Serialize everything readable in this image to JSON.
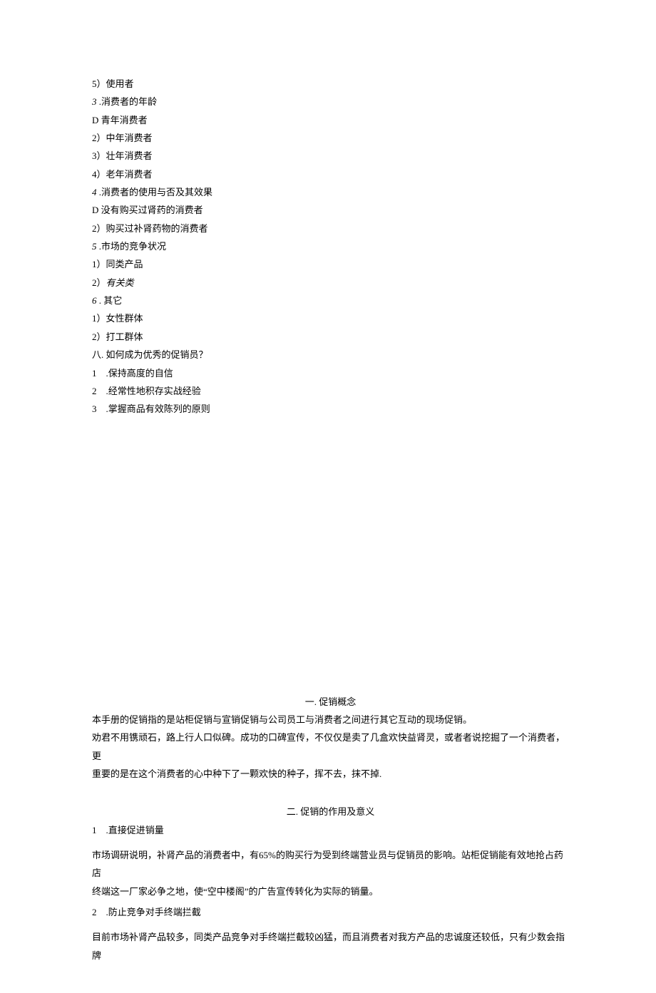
{
  "upper": {
    "l01": "5）使用者",
    "l02_num": "3",
    "l02_txt": " .消费者的年龄",
    "l03": "D 青年消费者",
    "l04": "2）中年消费者",
    "l05": "3）壮年消费者",
    "l06": "4）老年消费者",
    "l07_num": "4",
    "l07_txt": " .消费者的使用与否及其效果",
    "l08": "D 没有购买过肾药的消费者",
    "l09": "2）购买过补肾药物的消费者",
    "l10_num": "5",
    "l10_txt": " .市场的竞争状况",
    "l11": "1）同类产品",
    "l12_pre": "2）",
    "l12_txt": "有关类",
    "l13_num": "6",
    "l13_txt": " . 其它",
    "l14": "1）女性群体",
    "l15": "2）打工群体",
    "l16": "八. 如何成为优秀的促销员？",
    "l17": "1　.保持高度的自信",
    "l18": "2　.经常性地积存实战经验",
    "l19": "3　.掌握商品有效陈列的原则"
  },
  "lower": {
    "h1": "一. 促销概念",
    "p1a": "本手册的促销指的是站柜促销与宣销促销与公司员工与消费者之间进行其它互动的现场促销。",
    "p1b": "劝君不用镌顽石，路上行人口似碑。成功的口碑宣传，不仅仅是卖了几盒欢快益肾灵，或者者说挖掘了一个消费者，更",
    "p1c": "重要的是在这个消费者的心中种下了一颗欢快的种子，挥不去，抹不掉.",
    "h2": "二. 促销的作用及意义",
    "s1": "1　.直接促进销量",
    "p2a": "市场调研说明，补肾产品的消费者中，有65%的购买行为受到终端营业员与促销员的影响。站柜促销能有效地抢占药店",
    "p2b": "终端这一厂家必争之地，使“空中楼阁”的广告宣传转化为实际的销量。",
    "s2": "2　.防止竞争对手终端拦截",
    "p3": "目前市场补肾产品较多，同类产品竞争对手终端拦截较凶猛，而且消费者对我方产品的忠诚度还较低，只有少数会指牌"
  }
}
